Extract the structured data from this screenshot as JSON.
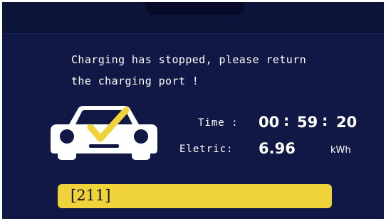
{
  "message": {
    "line1": "Charging has stopped, please return",
    "line2": "the charging port !"
  },
  "stats": {
    "time_label": "Time :",
    "time_hours": "00",
    "time_minutes": "59",
    "time_seconds": "20",
    "time_separator": ":",
    "electric_label": "Eletric:",
    "electric_value": "6.96",
    "electric_unit": "kWh"
  },
  "code": {
    "text": "[211]"
  },
  "icons": {
    "car": "car-icon",
    "check": "checkmark-icon"
  },
  "colors": {
    "screen_background": "#111845",
    "code_bar": "#f0d23a",
    "checkmark": "#f0d23a",
    "text": "#ffffff"
  }
}
